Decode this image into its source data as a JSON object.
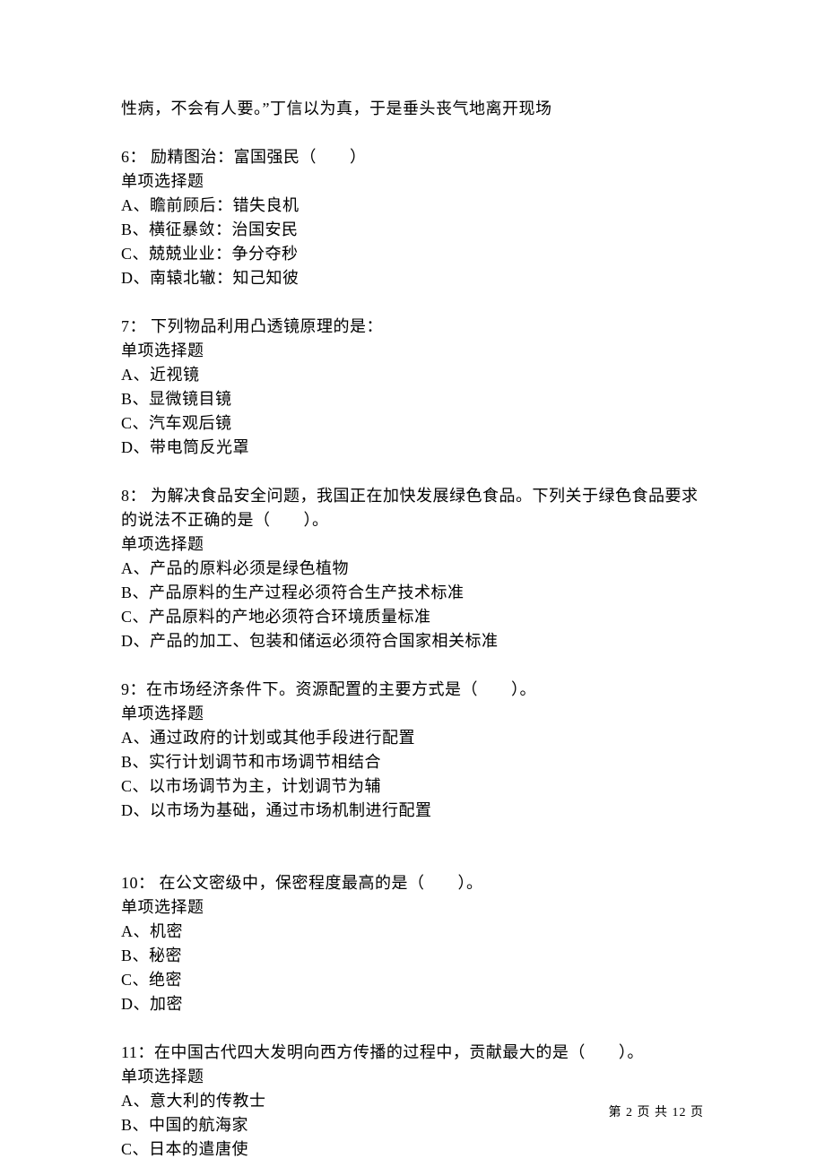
{
  "continuation": "性病，不会有人要。”丁信以为真，于是垂头丧气地离开现场",
  "questions": [
    {
      "number": "6：",
      "stem": " 励精图治：富国强民（　　）",
      "type": "单项选择题",
      "options": [
        "A、瞻前顾后：错失良机",
        "B、横征暴敛：治国安民",
        "C、兢兢业业：争分夺秒",
        "D、南辕北辙：知己知彼"
      ]
    },
    {
      "number": "7：",
      "stem": " 下列物品利用凸透镜原理的是：",
      "type": "单项选择题",
      "options": [
        "A、近视镜",
        "B、显微镜目镜",
        "C、汽车观后镜",
        "D、带电筒反光罩"
      ]
    },
    {
      "number": "8：",
      "stem": " 为解决食品安全问题，我国正在加快发展绿色食品。下列关于绿色食品要求的说法不正确的是（　　）。",
      "type": "单项选择题",
      "options": [
        "A、产品的原料必须是绿色植物",
        "B、产品原料的生产过程必须符合生产技术标准",
        "C、产品原料的产地必须符合环境质量标准",
        "D、产品的加工、包装和储运必须符合国家相关标准"
      ]
    },
    {
      "number": "9：",
      "stem": "在市场经济条件下。资源配置的主要方式是（　　）。",
      "type": "单项选择题",
      "options": [
        "A、通过政府的计划或其他手段进行配置",
        "B、实行计划调节和市场调节相结合",
        "C、以市场调节为主，计划调节为辅",
        "D、以市场为基础，通过市场机制进行配置"
      ]
    },
    {
      "number": "10：",
      "stem": " 在公文密级中，保密程度最高的是（　　）。",
      "type": "单项选择题",
      "options": [
        "A、机密",
        "B、秘密",
        "C、绝密",
        "D、加密"
      ]
    },
    {
      "number": "11：",
      "stem": "在中国古代四大发明向西方传播的过程中，贡献最大的是（　　）。",
      "type": "单项选择题",
      "options": [
        "A、意大利的传教士",
        "B、中国的航海家",
        "C、日本的遣唐使"
      ]
    }
  ],
  "footer": {
    "text": "第 2 页 共 12 页"
  }
}
